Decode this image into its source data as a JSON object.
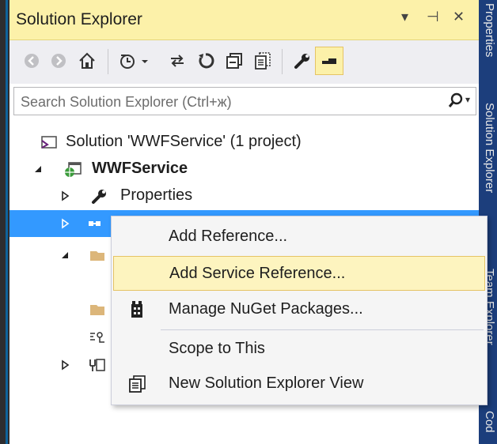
{
  "window": {
    "title": "Solution Explorer",
    "title_buttons": {
      "dropdown": "▾",
      "pin": "⊣",
      "close": "✕"
    }
  },
  "side_tabs": {
    "top": "Properties",
    "middle": "Solution Explorer",
    "lower": "Team Explorer",
    "bottom": "Cod"
  },
  "toolbar": {
    "icons": [
      "back-icon",
      "forward-icon",
      "home-icon",
      "pending-changes-icon",
      "sync-icon",
      "refresh-icon",
      "collapse-all-icon",
      "show-all-files-icon",
      "properties-wrench-icon",
      "preview-selected-icon"
    ]
  },
  "search": {
    "placeholder": "Search Solution Explorer (Ctrl+ж)",
    "value": ""
  },
  "tree": {
    "solution_label": "Solution 'WWFService' (1 project)",
    "project_label": "WWFService",
    "properties_label": "Properties"
  },
  "context_menu": {
    "items": [
      {
        "label": "Add Reference...",
        "icon": ""
      },
      {
        "label": "Add Service Reference...",
        "icon": ""
      },
      {
        "label": "Manage NuGet Packages...",
        "icon": "nuget-icon"
      },
      {
        "label": "Scope to This",
        "icon": ""
      },
      {
        "label": "New Solution Explorer View",
        "icon": "new-explorer-view-icon"
      }
    ],
    "hovered_index": 1
  },
  "colors": {
    "title_bar": "#fcf1a9",
    "selection": "#3399ff",
    "menu_hover": "#fdf4bf",
    "side_panel": "#1c3e7c",
    "toolbar_active": "#fcf1a9"
  }
}
